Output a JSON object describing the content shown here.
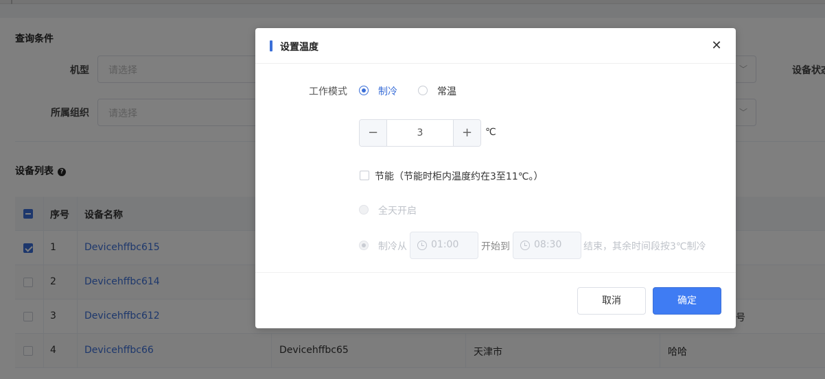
{
  "page": {
    "query_title": "查询条件",
    "filters": [
      {
        "label": "机型",
        "placeholder": "请选择"
      },
      {
        "label": "所属组织",
        "placeholder": "请选择"
      }
    ],
    "status_label": "设备状态",
    "list_title": "设备列表",
    "table": {
      "headers": [
        "序号",
        "设备名称"
      ],
      "rows": [
        {
          "index": "1",
          "name": "Devicehffbc615",
          "checked": true,
          "col3": "",
          "col4": "",
          "col5": ""
        },
        {
          "index": "2",
          "name": "Devicehffbc614",
          "checked": false,
          "col3": "",
          "col4": "",
          "col5": ""
        },
        {
          "index": "3",
          "name": "Devicehffbc612",
          "checked": false,
          "col3": "",
          "col4": "",
          "col5": "号"
        },
        {
          "index": "4",
          "name": "Devicehffbc66",
          "checked": false,
          "col3": "Devicehffbc65",
          "col4": "天津市",
          "col5": "哈哈"
        }
      ]
    }
  },
  "dialog": {
    "title": "设置温度",
    "close_glyph": "✕",
    "mode_label": "工作模式",
    "modes": [
      {
        "label": "制冷",
        "selected": true
      },
      {
        "label": "常温",
        "selected": false
      }
    ],
    "stepper": {
      "minus": "−",
      "plus": "+",
      "value": "3",
      "unit": "℃"
    },
    "energy_saving": {
      "label": "节能（节能时柜内温度约在3至11℃。）",
      "checked": false
    },
    "schedule": {
      "all_day_label": "全天开启",
      "from_label": "制冷从",
      "start_time": "01:00",
      "mid_label": "开始到",
      "end_time": "08:30",
      "tail_label": "结束，其余时间段按3℃制冷"
    },
    "cancel_label": "取消",
    "confirm_label": "确定"
  },
  "colors": {
    "accent": "#3f7cf3",
    "link": "#3b6fd8"
  }
}
